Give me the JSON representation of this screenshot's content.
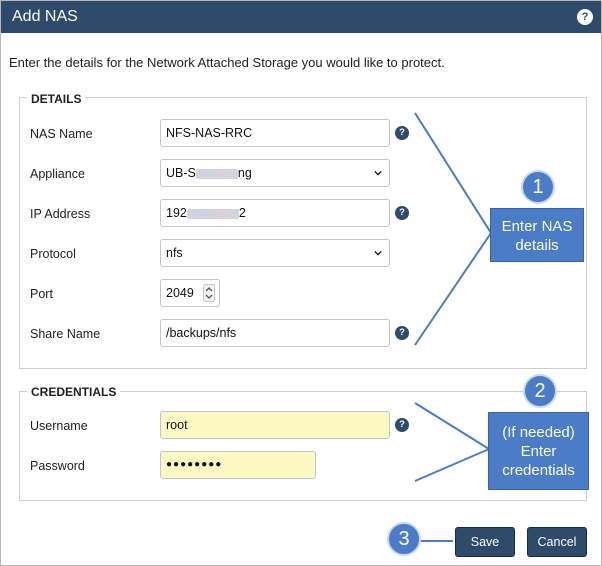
{
  "dialog": {
    "title": "Add NAS",
    "help_glyph": "?",
    "intro": "Enter the details for the Network Attached Storage you would like to protect."
  },
  "details": {
    "legend": "DETAILS",
    "nas_name": {
      "label": "NAS Name",
      "value": "NFS-NAS-RRC"
    },
    "appliance": {
      "label": "Appliance",
      "value_prefix": "UB-S",
      "value_suffix": "ng"
    },
    "ip_address": {
      "label": "IP Address",
      "value_prefix": "192",
      "value_suffix": "2"
    },
    "protocol": {
      "label": "Protocol",
      "value": "nfs"
    },
    "port": {
      "label": "Port",
      "value": "2049"
    },
    "share_name": {
      "label": "Share Name",
      "value": "/backups/nfs"
    }
  },
  "credentials": {
    "legend": "CREDENTIALS",
    "username": {
      "label": "Username",
      "value": "root"
    },
    "password": {
      "label": "Password",
      "value": "●●●●●●●●"
    }
  },
  "buttons": {
    "save": "Save",
    "cancel": "Cancel"
  },
  "callouts": [
    {
      "number": "1",
      "text_line1": "Enter NAS",
      "text_line2": "details"
    },
    {
      "number": "2",
      "text_line1": "(If needed)",
      "text_line2": "Enter",
      "text_line3": "credentials"
    },
    {
      "number": "3"
    }
  ],
  "icons": {
    "help": "question-circle-icon",
    "select": "chevron-down-icon",
    "stepper": "spin-updown-icon"
  },
  "colors": {
    "titlebar": "#2f4b6b",
    "button": "#2f4b6b",
    "callout": "#4a7cc7",
    "autofill": "#fcf8c4"
  }
}
